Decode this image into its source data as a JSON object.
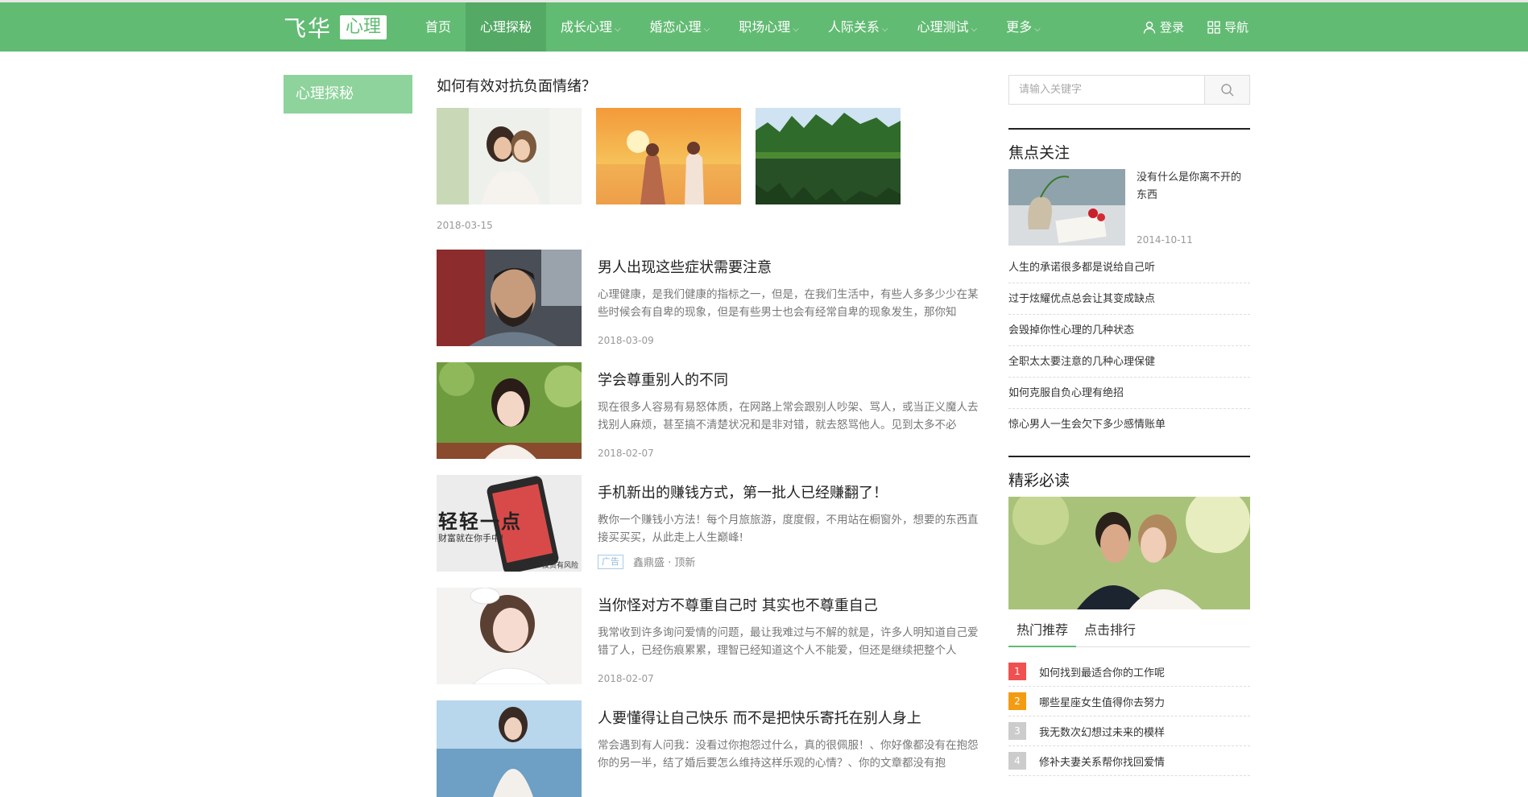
{
  "brand": {
    "name": "飞华",
    "tag": "心理",
    "primary_color": "#62bb73",
    "active_nav_color": "#54a965"
  },
  "nav": {
    "items": [
      {
        "label": "首页",
        "dropdown": false
      },
      {
        "label": "心理探秘",
        "dropdown": false,
        "active": true
      },
      {
        "label": "成长心理",
        "dropdown": true
      },
      {
        "label": "婚恋心理",
        "dropdown": true
      },
      {
        "label": "职场心理",
        "dropdown": true
      },
      {
        "label": "人际关系",
        "dropdown": true
      },
      {
        "label": "心理测试",
        "dropdown": true
      },
      {
        "label": "更多",
        "dropdown": true
      }
    ],
    "login": {
      "label": "登录",
      "icon": "user-icon"
    },
    "guide": {
      "label": "导航",
      "icon": "grid-icon"
    }
  },
  "category": {
    "label": "心理探秘"
  },
  "posts": [
    {
      "title": "如何有效对抗负面情绪？",
      "date": "2018-03-15",
      "images": [
        "two-women-comfort-photo",
        "sunset-couple-photo",
        "lake-forest-photo"
      ]
    },
    {
      "title": "男人出现这些症状需要注意",
      "excerpt": "心理健康，是我们健康的指标之一，但是，在我们生活中，有些人多多少少在某些时候会有自卑的现象，但是有些男士也会有经常自卑的现象发生，那你知",
      "date": "2018-03-09",
      "image": "bearded-man-photo"
    },
    {
      "title": "学会尊重别人的不同",
      "excerpt": "现在很多人容易有易怒体质，在网路上常会跟别人吵架、骂人，或当正义魔人去找别人麻烦，甚至搞不清楚状况和是非对错，就去怒骂他人。见到太多不必",
      "date": "2018-02-07",
      "image": "young-woman-greenery-photo"
    },
    {
      "title": "手机新出的赚钱方式，第一批人已经赚翻了！",
      "excerpt": "教你一个赚钱小方法！每个月旅旅游，度度假，不用站在橱窗外，想要的东西直接买买买，从此走上人生巅峰!",
      "image": "phone-ad-photo",
      "image_text": {
        "big": "轻轻一点",
        "small": "财富就在你手中!",
        "risk": "投资有风险"
      },
      "ad_badge": "广告",
      "ad_source": "鑫鼎盛 · 顶新"
    },
    {
      "title": "当你怪对方不尊重自己时 其实也不尊重自己",
      "excerpt": "我常收到许多询问爱情的问题，最让我难过与不解的就是，许多人明知道自己爱错了人，已经伤痕累累，理智已经知道这个人不能爱，但还是继续把整个人",
      "date": "2018-02-07",
      "image": "woman-white-dress-photo"
    },
    {
      "title": "人要懂得让自己快乐 而不是把快乐寄托在别人身上",
      "excerpt": "常会遇到有人问我：没看过你抱怨过什么，真的很佩服！、你好像都没有在抱怨你的另一半，结了婚后要怎么维持这样乐观的心情？、你的文章都没有抱",
      "image": "woman-seaside-photo"
    }
  ],
  "search": {
    "placeholder": "请输入关键字"
  },
  "focus": {
    "title": "焦点关注",
    "top": {
      "title": "没有什么是你离不开的东西",
      "date": "2014-10-11",
      "image": "vase-book-roses-photo"
    },
    "items": [
      "人生的承诺很多都是说给自己听",
      "过于炫耀优点总会让其变成缺点",
      "会毁掉你性心理的几种状态",
      "全职太太要注意的几种心理保健",
      "如何克服自负心理有绝招",
      "惊心男人一生会欠下多少感情账单"
    ]
  },
  "featured": {
    "title": "精彩必读",
    "image": "wedding-couple-photo",
    "tabs": [
      "热门推荐",
      "点击排行"
    ],
    "rank": [
      {
        "num": "1",
        "title": "如何找到最适合你的工作呢",
        "color": "#f05050"
      },
      {
        "num": "2",
        "title": "哪些星座女生值得你去努力",
        "color": "#f39c12"
      },
      {
        "num": "3",
        "title": "我无数次幻想过未来的模样",
        "color": "#cccccc"
      },
      {
        "num": "4",
        "title": "修补夫妻关系帮你找回爱情",
        "color": "#cccccc"
      }
    ]
  }
}
